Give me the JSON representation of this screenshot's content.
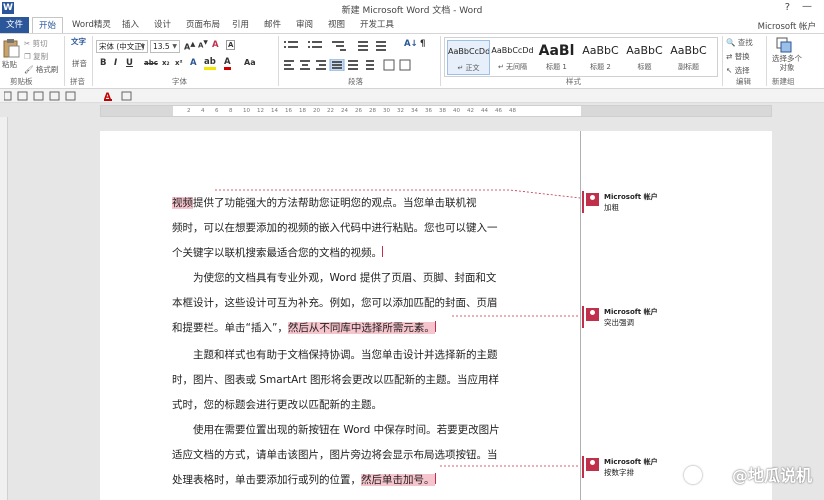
{
  "window": {
    "title": "新建 Microsoft Word 文档 - Word",
    "help": "?",
    "account": "Microsoft 帐户"
  },
  "tabs": [
    "文件",
    "开始",
    "Word精灵",
    "插入",
    "设计",
    "页面布局",
    "引用",
    "邮件",
    "审阅",
    "视图",
    "开发工具"
  ],
  "ribbon": {
    "clipboard": {
      "paste": "粘贴",
      "cut": "剪切",
      "copy": "复制",
      "format_painter": "格式刷",
      "label": "剪贴板"
    },
    "pinyin": {
      "label_top": "文字",
      "button": "拼音",
      "label": "拼音"
    },
    "font": {
      "name": "宋体 (中文正)",
      "size": "13.5",
      "label": "字体"
    },
    "paragraph": {
      "label": "段落"
    },
    "styles": {
      "label": "样式",
      "items": [
        {
          "sample": "AaBbCcDd",
          "name": "↵ 正文"
        },
        {
          "sample": "AaBbCcDd",
          "name": "↵ 无间隔"
        },
        {
          "sample": "AaBl",
          "name": "标题 1"
        },
        {
          "sample": "AaBbC",
          "name": "标题 2"
        },
        {
          "sample": "AaBbC",
          "name": "标题"
        },
        {
          "sample": "AaBbC",
          "name": "副标题"
        }
      ]
    },
    "editing": {
      "find": "查找",
      "replace": "替换",
      "select": "选择",
      "label": "编辑"
    },
    "new_group": {
      "select_objects": "选择多个对象",
      "label": "新建组"
    }
  },
  "ruler": {
    "ticks": [
      "2",
      "4",
      "6",
      "8",
      "10",
      "12",
      "14",
      "16",
      "18",
      "20",
      "22",
      "24",
      "26",
      "28",
      "30",
      "32",
      "34",
      "36",
      "38",
      "40",
      "42",
      "44",
      "46",
      "48"
    ]
  },
  "document": {
    "lines": [
      {
        "pre": "",
        "hl": "视频",
        "post": "提供了功能强大的方法帮助您证明您的观点。当您单击联机视"
      },
      {
        "pre": "频时，可以在想要添加的视频的嵌入代码中进行粘贴。您也可以键入一",
        "hl": "",
        "post": ""
      },
      {
        "pre": "个关键字以联机搜索最适合您的文档的视频。",
        "hl": "",
        "post": ""
      },
      {
        "pre": "　　为使您的文档具有专业外观，Word 提供了页眉、页脚、封面和文",
        "hl": "",
        "post": ""
      },
      {
        "pre": "本框设计，这些设计可互为补充。例如，您可以添加匹配的封面、页眉",
        "hl": "",
        "post": ""
      },
      {
        "pre": "和提要栏。单击“插入”，",
        "hl": "然后从不同库中选择所需元素。",
        "post": ""
      },
      {
        "pre": "　　主题和样式也有助于文档保持协调。当您单击设计并选择新的主题",
        "hl": "",
        "post": ""
      },
      {
        "pre": "时，图片、图表或 SmartArt 图形将会更改以匹配新的主题。当应用样",
        "hl": "",
        "post": ""
      },
      {
        "pre": "式时，您的标题会进行更改以匹配新的主题。",
        "hl": "",
        "post": ""
      },
      {
        "pre": "　　使用在需要位置出现的新按钮在 Word 中保存时间。若要更改图片",
        "hl": "",
        "post": ""
      },
      {
        "pre": "适应文档的方式，请单击该图片，图片旁边将会显示布局选项按钮。当",
        "hl": "",
        "post": ""
      },
      {
        "pre": "处理表格时，单击要添加行或列的位置，",
        "hl": "然后单击加号。",
        "post": ""
      }
    ]
  },
  "comments": [
    {
      "author": "Microsoft 帐户",
      "text": "加粗"
    },
    {
      "author": "Microsoft 帐户",
      "text": "突出强调"
    },
    {
      "author": "Microsoft 帐户",
      "text": "按数字排"
    }
  ],
  "watermark": "@地瓜说机",
  "colors": {
    "accent": "#2b579a",
    "comment": "#c0304a",
    "highlight": "#f6c4cc"
  }
}
